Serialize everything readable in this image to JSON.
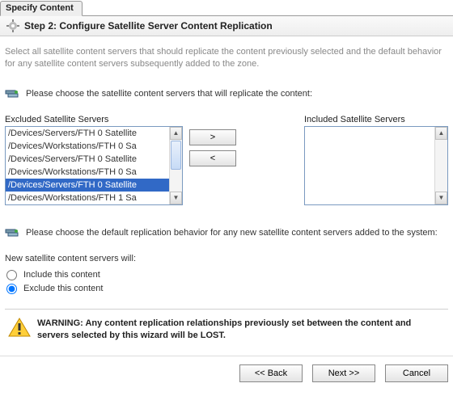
{
  "tab": {
    "label": "Specify Content"
  },
  "step": {
    "title": "Step 2: Configure Satellite Server Content Replication"
  },
  "intro": "Select all satellite content servers that should replicate the content previously selected and the default behavior for any satellite content servers subsequently added to the zone.",
  "section1": {
    "prompt": "Please choose the satellite content servers that will replicate the content:"
  },
  "lists": {
    "excluded_label": "Excluded Satellite Servers",
    "included_label": "Included Satellite Servers",
    "excluded_items": [
      "/Devices/Servers/FTH 0 Satellite",
      "/Devices/Workstations/FTH 0 Sa",
      "/Devices/Servers/FTH 0 Satellite",
      "/Devices/Workstations/FTH 0 Sa",
      "/Devices/Servers/FTH 0 Satellite",
      "/Devices/Workstations/FTH 1 Sa"
    ],
    "selected_index": 4,
    "move_right": ">",
    "move_left": "<"
  },
  "section2": {
    "prompt": "Please choose the default replication behavior for any new satellite content servers added to the system:"
  },
  "radio": {
    "heading": "New satellite content servers will:",
    "option_include": "Include this content",
    "option_exclude": "Exclude this content",
    "selected": "exclude"
  },
  "warning": {
    "text": "WARNING: Any content replication relationships previously set between the content and servers selected by this wizard will be LOST."
  },
  "buttons": {
    "back": "<< Back",
    "next": "Next >>",
    "cancel": "Cancel"
  }
}
